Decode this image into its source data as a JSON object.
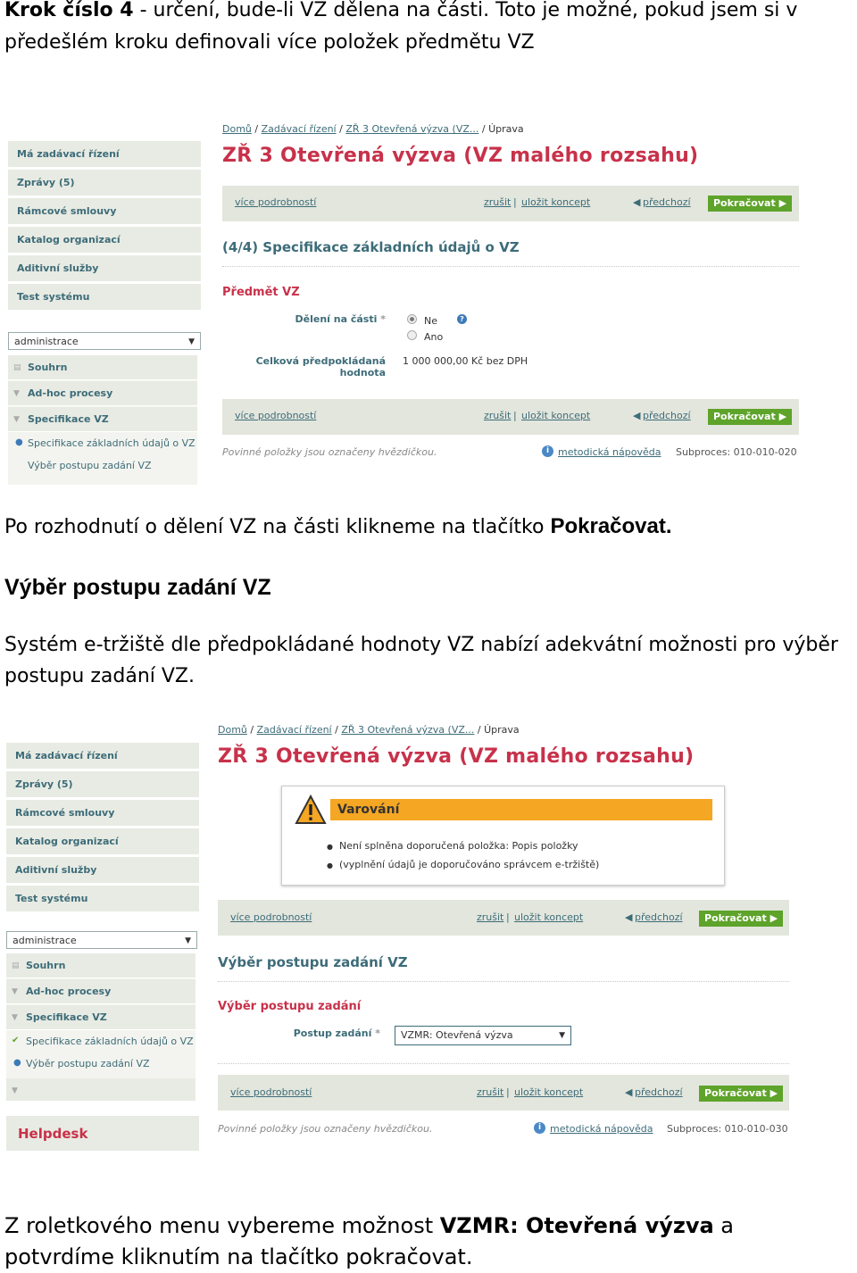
{
  "intro": {
    "step_bold": "Krok číslo 4",
    "step_rest": " - určení, bude-li VZ dělena na části. Toto je možné, pokud jsem si v",
    "line2": "předešlém kroku definovali více položek předmětu VZ"
  },
  "para1": {
    "text": "Po rozhodnutí o dělení VZ na části klikneme na tlačítko ",
    "bold": "Pokračovat."
  },
  "heading": "Výběr postupu zadání VZ",
  "para2": {
    "line1": "Systém e-tržiště dle předpokládané hodnoty VZ nabízí adekvátní možnosti pro výběr",
    "line2": "postupu zadání VZ."
  },
  "para3": {
    "pre": "Z roletkového menu vybereme možnost ",
    "bold": "VZMR: Otevřená výzva",
    "post": " a",
    "line2": "potvrdíme kliknutím na tlačítko pokračovat."
  },
  "sidebar": {
    "menu": [
      "Má zadávací řízení",
      "Zprávy (5)",
      "Rámcové smlouvy",
      "Katalog organizací",
      "Aditivní služby",
      "Test systému"
    ],
    "select_value": "administrace",
    "tree": [
      "Souhrn",
      "Ad-hoc procesy",
      "Specifikace VZ"
    ],
    "subitems": [
      "Specifikace základních údajů o VZ",
      "Výběr postupu zadání VZ"
    ],
    "helpdesk": "Helpdesk"
  },
  "breadcrumb": {
    "home": "Domů",
    "sep": "/",
    "c2": "Zadávací řízení",
    "c3": "ZŘ 3 Otevřená výzva (VZ...",
    "current": "Úprava"
  },
  "page_title": "ZŘ 3 Otevřená výzva (VZ malého rozsahu)",
  "actions": {
    "more": "více podrobností",
    "cancel": "zrušit",
    "divider": "|",
    "save": "uložit koncept",
    "prev": "předchozí",
    "next": "Pokračovat"
  },
  "shot1": {
    "section": "(4/4) Specifikace základních údajů o VZ",
    "subsection": "Předmět VZ",
    "division_label": "Dělení na části",
    "req": "*",
    "options": [
      "Ne",
      "Ano"
    ],
    "help": "?",
    "value_label_1": "Celková předpokládaná",
    "value_label_2": "hodnota",
    "value": "1 000 000,00 Kč bez DPH",
    "subprocess": "Subproces: 010-010-020"
  },
  "shot2": {
    "warning_title": "Varování",
    "warning_items": [
      "Není splněna doporučená položka: Popis položky",
      "(vyplnění údajů je doporučováno správcem e-tržiště)"
    ],
    "section": "Výběr postupu zadání VZ",
    "subsection": "Výběr postupu zadání",
    "proc_label": "Postup zadání",
    "req": "*",
    "proc_value": "VZMR: Otevřená výzva",
    "subprocess": "Subproces: 010-010-030"
  },
  "footer": {
    "note": "Povinné položky jsou označeny hvězdičkou.",
    "info": "i",
    "help_link": "metodická nápověda"
  },
  "colors": {
    "accent_red": "#c8314a",
    "link_teal": "#3d6c79",
    "button_green": "#5ea32a",
    "warning_orange": "#f5a623"
  }
}
